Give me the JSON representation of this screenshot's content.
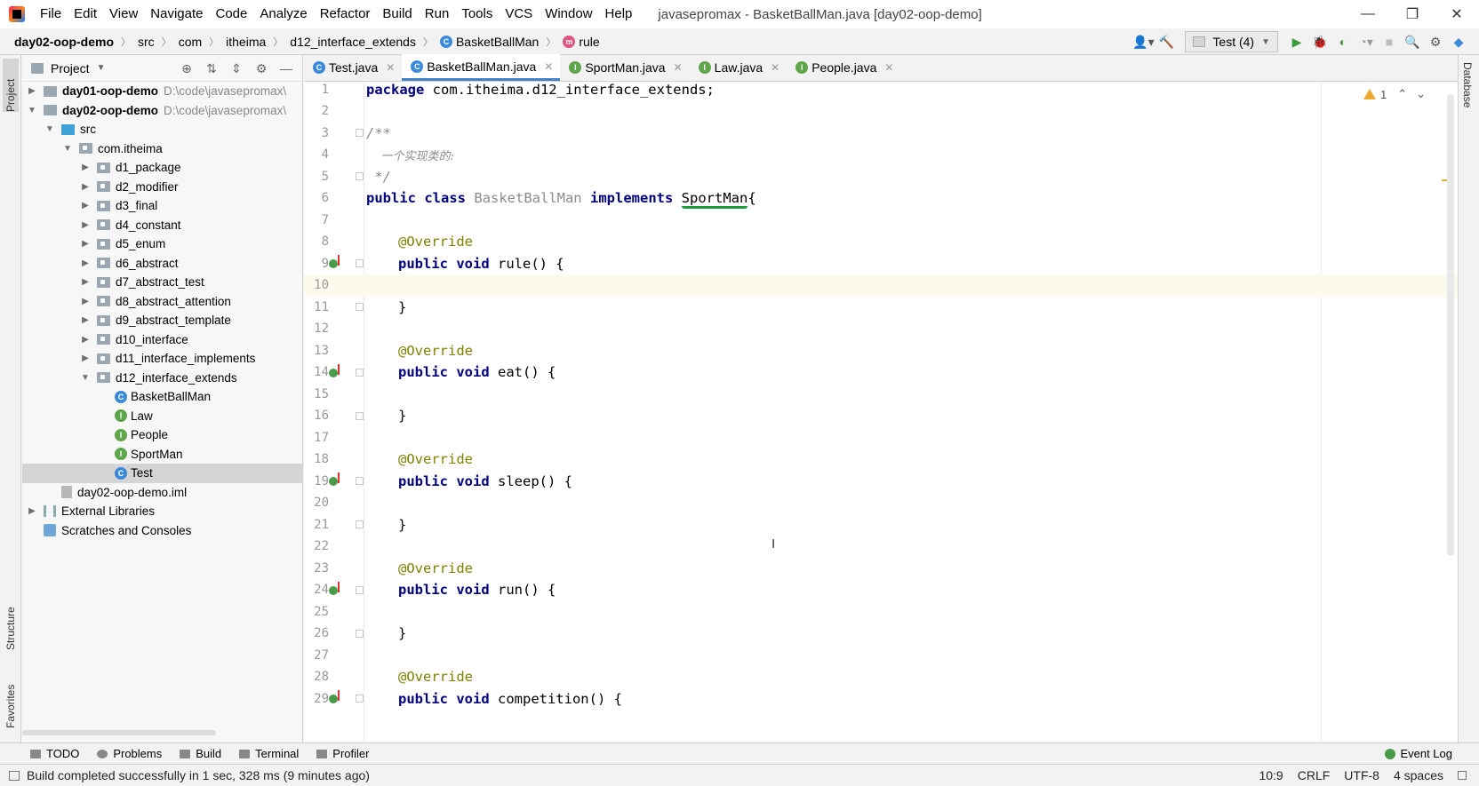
{
  "titlebar": {
    "menu": [
      "File",
      "Edit",
      "View",
      "Navigate",
      "Code",
      "Analyze",
      "Refactor",
      "Build",
      "Run",
      "Tools",
      "VCS",
      "Window",
      "Help"
    ],
    "window_title": "javasepromax - BasketBallMan.java [day02-oop-demo]",
    "minimize": "—",
    "restore": "❐",
    "close": "✕"
  },
  "navbar": {
    "breadcrumb": [
      "day02-oop-demo",
      "src",
      "com",
      "itheima",
      "d12_interface_extends",
      "BasketBallMan",
      "rule"
    ],
    "run_config": "Test (4)"
  },
  "left_strip": {
    "project": "Project",
    "structure": "Structure",
    "favorites": "Favorites"
  },
  "project_panel": {
    "title": "Project",
    "tree": [
      {
        "label": "day01-oop-demo",
        "path": "D:\\code\\javasepromax\\"
      },
      {
        "label": "day02-oop-demo",
        "path": "D:\\code\\javasepromax\\"
      },
      {
        "label": "src"
      },
      {
        "label": "com.itheima"
      },
      {
        "label": "d1_package"
      },
      {
        "label": "d2_modifier"
      },
      {
        "label": "d3_final"
      },
      {
        "label": "d4_constant"
      },
      {
        "label": "d5_enum"
      },
      {
        "label": "d6_abstract"
      },
      {
        "label": "d7_abstract_test"
      },
      {
        "label": "d8_abstract_attention"
      },
      {
        "label": "d9_abstract_template"
      },
      {
        "label": "d10_interface"
      },
      {
        "label": "d11_interface_implements"
      },
      {
        "label": "d12_interface_extends"
      },
      {
        "label": "BasketBallMan"
      },
      {
        "label": "Law"
      },
      {
        "label": "People"
      },
      {
        "label": "SportMan"
      },
      {
        "label": "Test"
      },
      {
        "label": "day02-oop-demo.iml"
      },
      {
        "label": "External Libraries"
      },
      {
        "label": "Scratches and Consoles"
      }
    ]
  },
  "editor_tabs": [
    "Test.java",
    "BasketBallMan.java",
    "SportMan.java",
    "Law.java",
    "People.java"
  ],
  "editor": {
    "line_numbers": [
      "1",
      "2",
      "3",
      "4",
      "5",
      "6",
      "7",
      "8",
      "9",
      "10",
      "11",
      "12",
      "13",
      "14",
      "15",
      "16",
      "17",
      "18",
      "19",
      "20",
      "21",
      "22",
      "23",
      "24",
      "25",
      "26",
      "27",
      "28",
      "29"
    ],
    "inspection_count": "1",
    "code": {
      "l1_kw": "package",
      "l1_rest": " com.itheima.d12_interface_extends;",
      "l3": "/**",
      "l4": "    一个实现类的:",
      "l5": " */",
      "l6_kw1": "public class",
      "l6_cls": "BasketBallMan",
      "l6_kw2": "implements",
      "l6_iface": "SportMan",
      "l6_brace": "{",
      "annotation": "@Override",
      "method_kw": "public void",
      "m_rule": " rule() {",
      "m_eat": " eat() {",
      "m_sleep": " sleep() {",
      "m_run": " run() {",
      "m_competition": " competition() {",
      "close_brace": "}"
    }
  },
  "right_strip": {
    "database": "Database"
  },
  "bottom_tools": [
    "TODO",
    "Problems",
    "Build",
    "Terminal",
    "Profiler"
  ],
  "event_log": "Event Log",
  "statusbar": {
    "message": "Build completed successfully in 1 sec, 328 ms (9 minutes ago)",
    "position": "10:9",
    "line_sep": "CRLF",
    "encoding": "UTF-8",
    "indent": "4 spaces"
  }
}
